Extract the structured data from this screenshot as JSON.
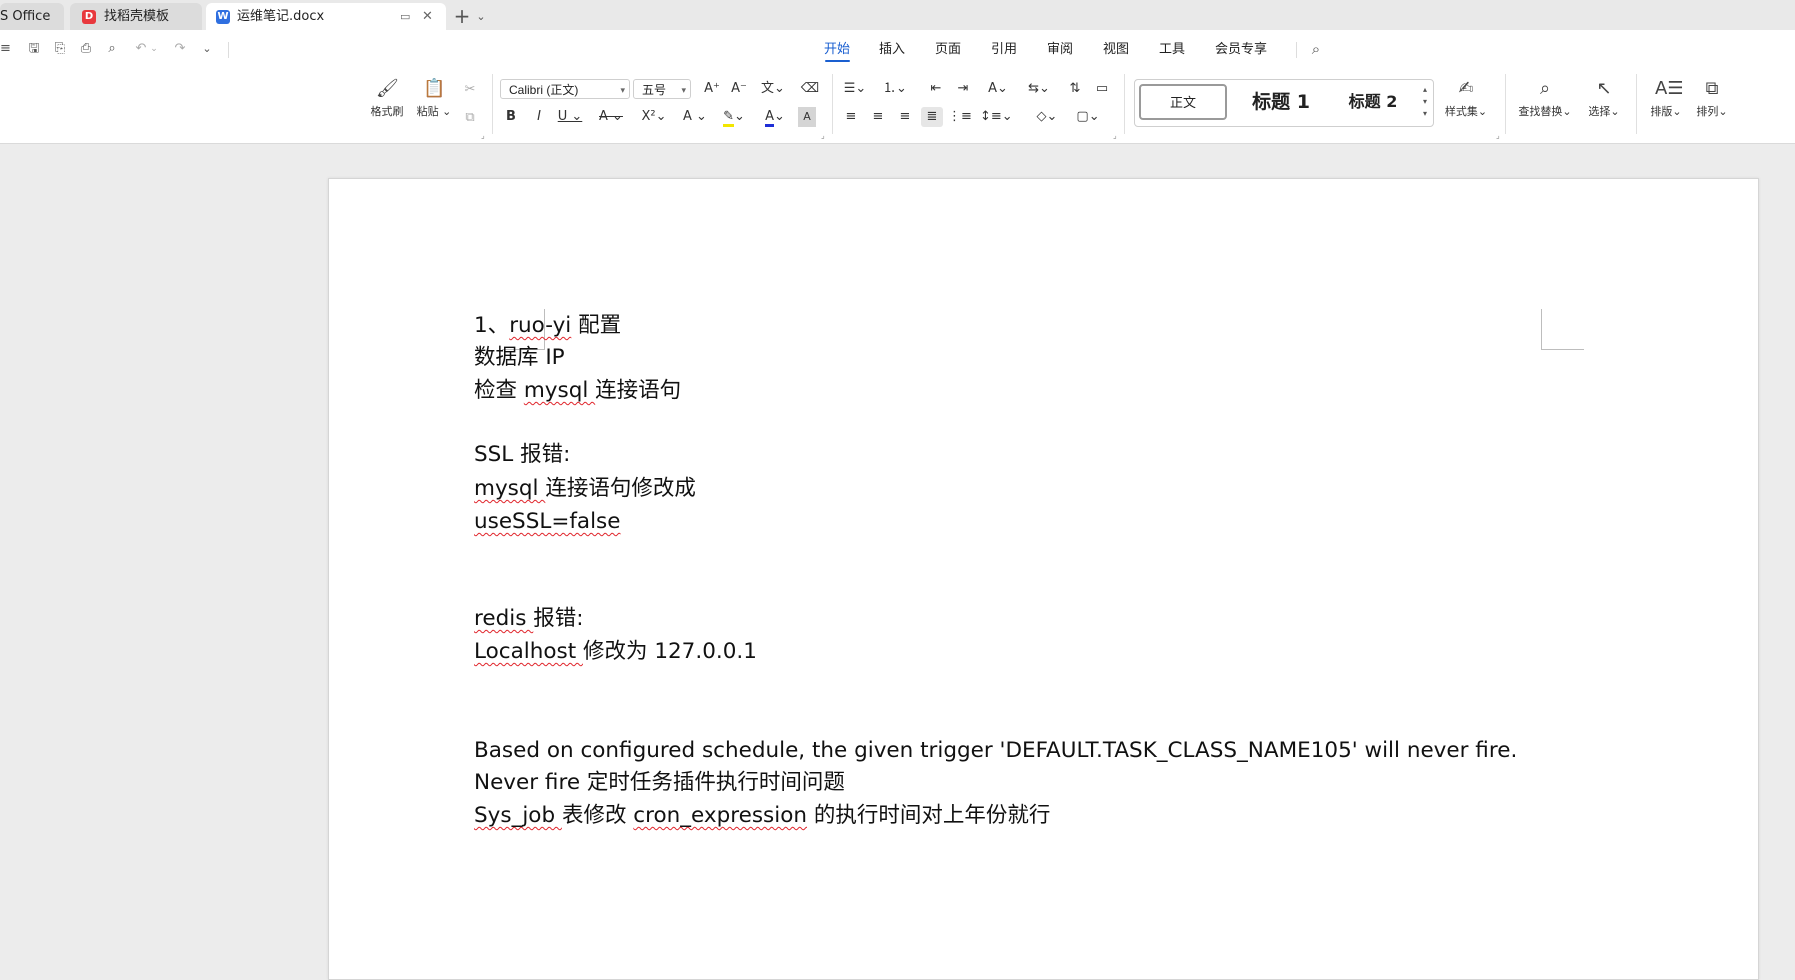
{
  "tabs": [
    {
      "label": "S Office"
    },
    {
      "label": "找稻壳模板",
      "icon": "docer-icon"
    },
    {
      "label": "运维笔记.docx",
      "icon": "word-doc-icon",
      "icon_letter": "W"
    }
  ],
  "tab_controls": {
    "new_tab": "+",
    "dropdown": "⌄"
  },
  "menu": {
    "items": [
      "开始",
      "插入",
      "页面",
      "引用",
      "审阅",
      "视图",
      "工具",
      "会员专享"
    ],
    "active": "开始"
  },
  "ribbon": {
    "clipboard": {
      "format_painter": "格式刷",
      "paste": "粘贴"
    },
    "font": {
      "family": "Calibri (正文)",
      "size": "五号"
    },
    "styles": {
      "normal": "正文",
      "heading1": "标题  1",
      "heading2": "标题  2",
      "style_set": "样式集"
    },
    "find_replace": "查找替换",
    "select": "选择",
    "layout": "排版",
    "arrange": "排列",
    "accent_color": "#1a5fd0"
  },
  "document": {
    "lines": [
      [
        {
          "t": "1、"
        },
        {
          "t": "ruo-yi",
          "sq": true
        },
        {
          "t": " 配置"
        }
      ],
      [
        {
          "t": "数据库 IP"
        }
      ],
      [
        {
          "t": "检查 "
        },
        {
          "t": "mysql ",
          "sq": true
        },
        {
          "t": "连接语句"
        }
      ],
      [
        {
          "t": "SSL 报错:"
        }
      ],
      [
        {
          "t": "mysql ",
          "sq": true
        },
        {
          "t": "连接语句修改成"
        }
      ],
      [
        {
          "t": "useSSL=false",
          "sq": true
        }
      ],
      [
        {
          "t": "redis ",
          "sq": true
        },
        {
          "t": "报错:"
        }
      ],
      [
        {
          "t": "Localhost ",
          "sq": true
        },
        {
          "t": "修改为 127.0.0.1"
        }
      ],
      [
        {
          "t": "Based on configured schedule, the given trigger 'DEFAULT.TASK_CLASS_NAME105' will never fire."
        }
      ],
      [
        {
          "t": "Never fire  定时任务插件执行时间问题"
        }
      ],
      [
        {
          "t": "Sys_job ",
          "sq": true
        },
        {
          "t": "表修改 "
        },
        {
          "t": "cron_expression",
          "sq": true
        },
        {
          "t": "  的执行时间对上年份就行"
        }
      ]
    ]
  }
}
